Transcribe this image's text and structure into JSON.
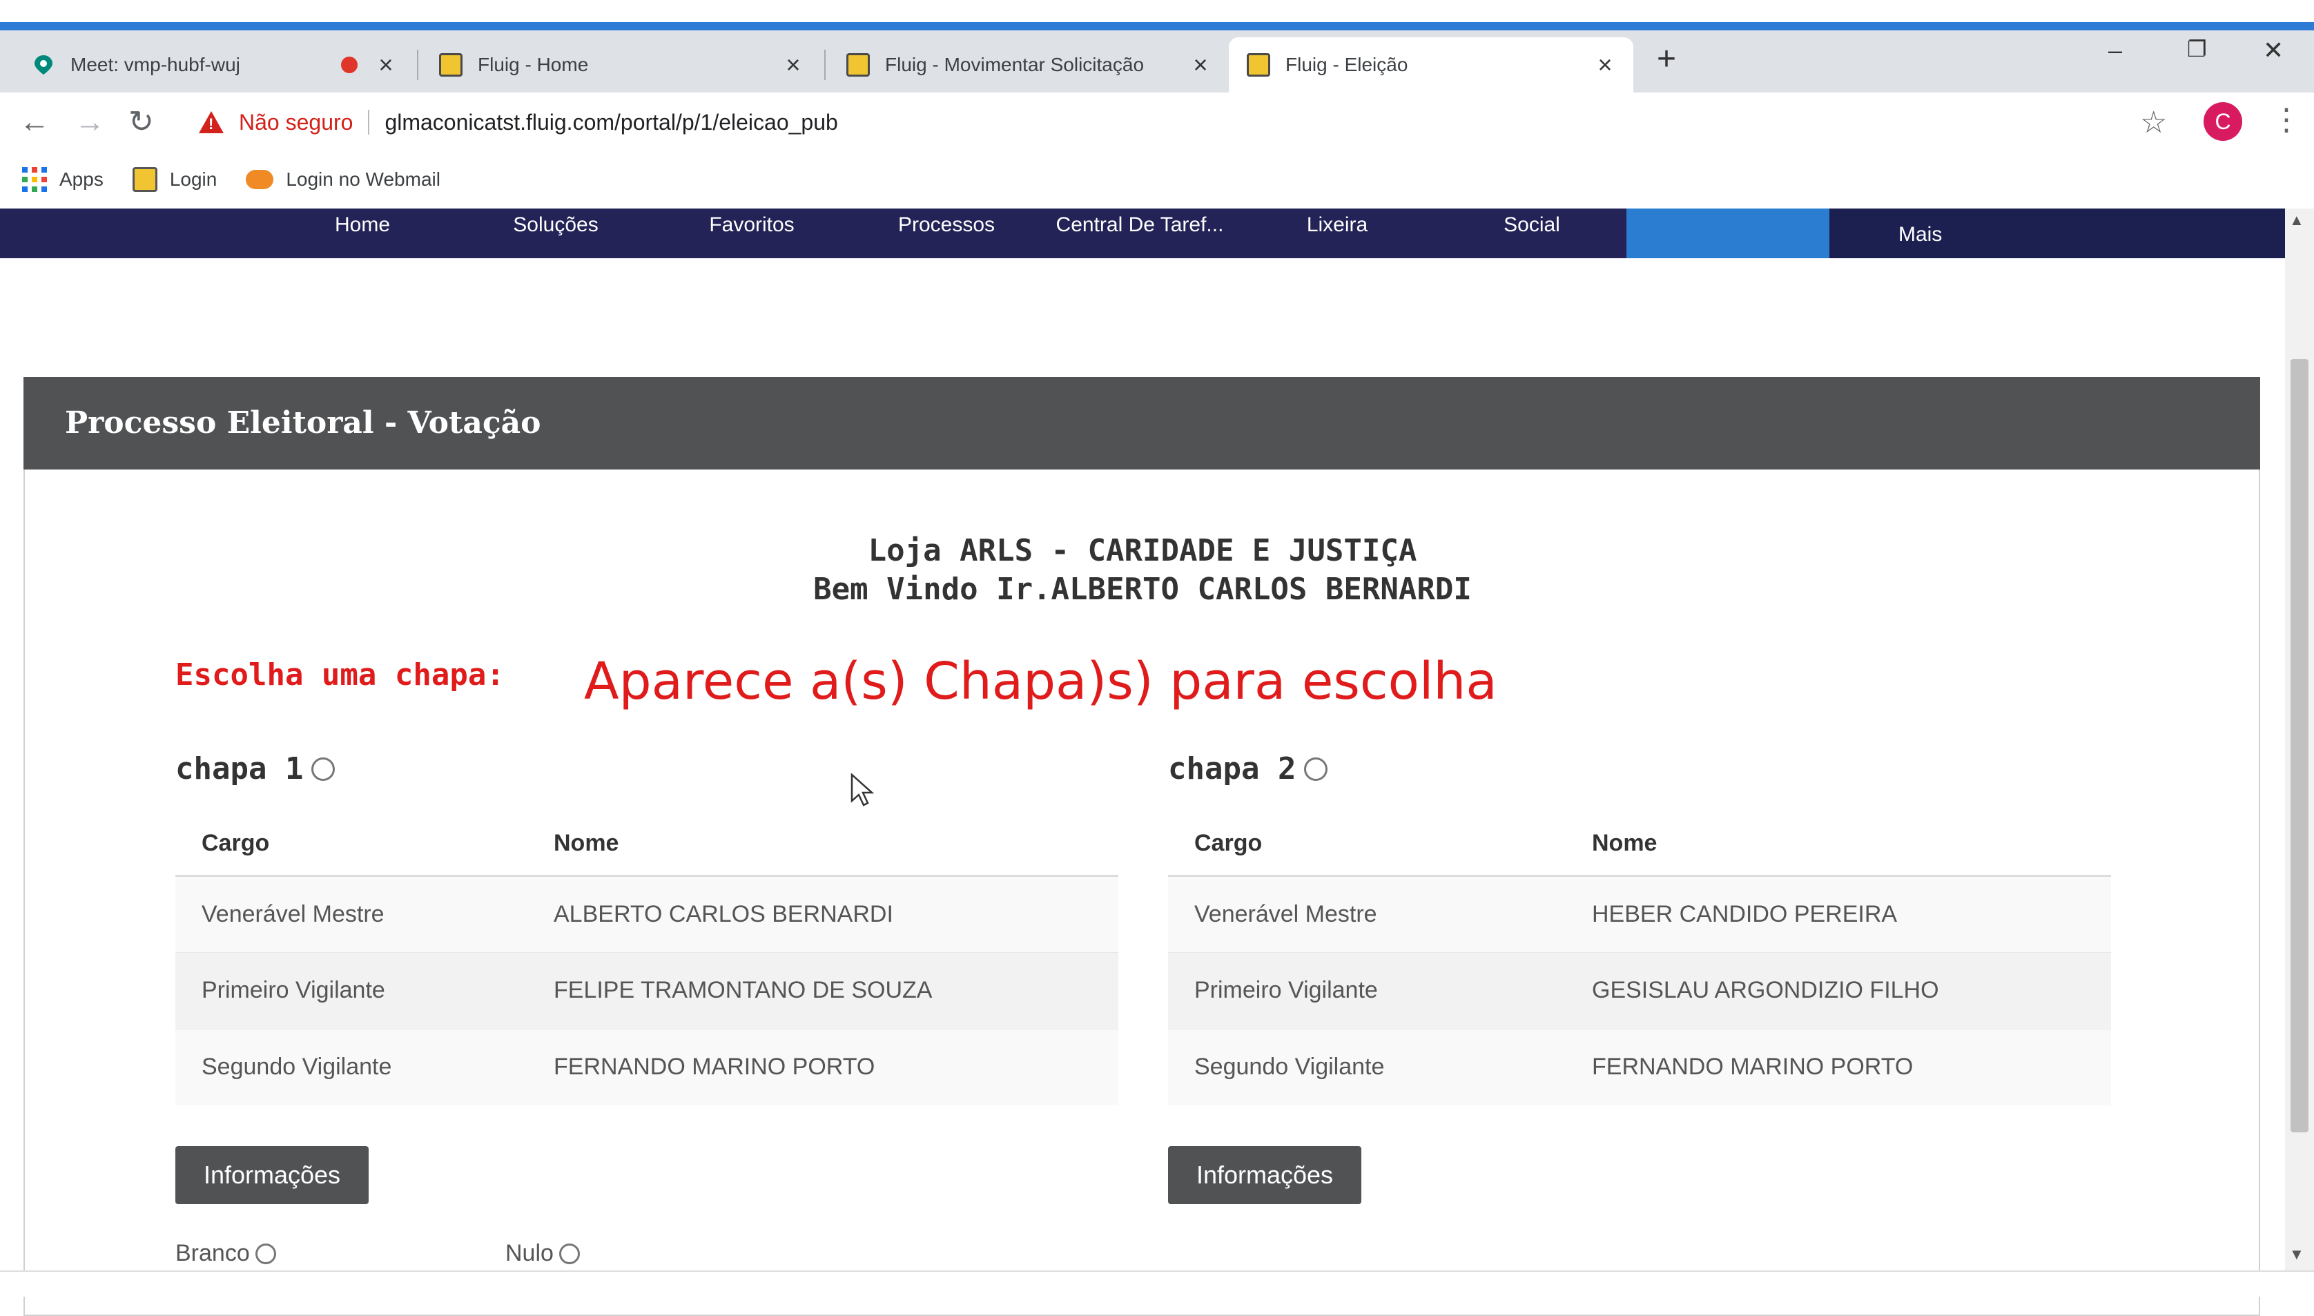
{
  "browser": {
    "tabs": [
      {
        "title": "Meet: vmp-hubf-wuj",
        "recording": true
      },
      {
        "title": "Fluig - Home"
      },
      {
        "title": "Fluig - Movimentar Solicitação"
      },
      {
        "title": "Fluig - Eleição",
        "active": true
      }
    ],
    "new_tab_icon": "+",
    "address": {
      "warning": "Não seguro",
      "url": "glmaconicatst.fluig.com/portal/p/1/eleicao_pub"
    },
    "avatar_initial": "C",
    "bookmarks": [
      "Apps",
      "Login",
      "Login no Webmail"
    ]
  },
  "site_nav": {
    "items": [
      "Home",
      "Soluções",
      "Favoritos",
      "Processos",
      "Central De Taref...",
      "Lixeira",
      "Social"
    ],
    "more": "Mais"
  },
  "panel": {
    "title": "Processo Eleitoral - Votação",
    "lodge": "Loja ARLS - CARIDADE E JUSTIÇA",
    "welcome": "Bem Vindo Ir.ALBERTO CARLOS BERNARDI",
    "choose_label": "Escolha uma chapa:",
    "annotation": "Aparece a(s) Chapa)s) para escolha",
    "columns": {
      "cargo": "Cargo",
      "nome": "Nome"
    },
    "slates": [
      {
        "label": "chapa 1",
        "rows": [
          {
            "cargo": "Venerável Mestre",
            "nome": "ALBERTO CARLOS BERNARDI"
          },
          {
            "cargo": "Primeiro Vigilante",
            "nome": "FELIPE TRAMONTANO DE SOUZA"
          },
          {
            "cargo": "Segundo Vigilante",
            "nome": "FERNANDO MARINO PORTO"
          }
        ],
        "button": "Informações"
      },
      {
        "label": "chapa 2",
        "rows": [
          {
            "cargo": "Venerável Mestre",
            "nome": "HEBER CANDIDO PEREIRA"
          },
          {
            "cargo": "Primeiro Vigilante",
            "nome": "GESISLAU ARGONDIZIO FILHO"
          },
          {
            "cargo": "Segundo Vigilante",
            "nome": "FERNANDO MARINO PORTO"
          }
        ],
        "button": "Informações"
      }
    ],
    "options": {
      "branco": "Branco",
      "nulo": "Nulo"
    }
  },
  "colors": {
    "accent_red": "#e01b1b",
    "nav_bg": "#232357",
    "panel_header": "#505254"
  }
}
